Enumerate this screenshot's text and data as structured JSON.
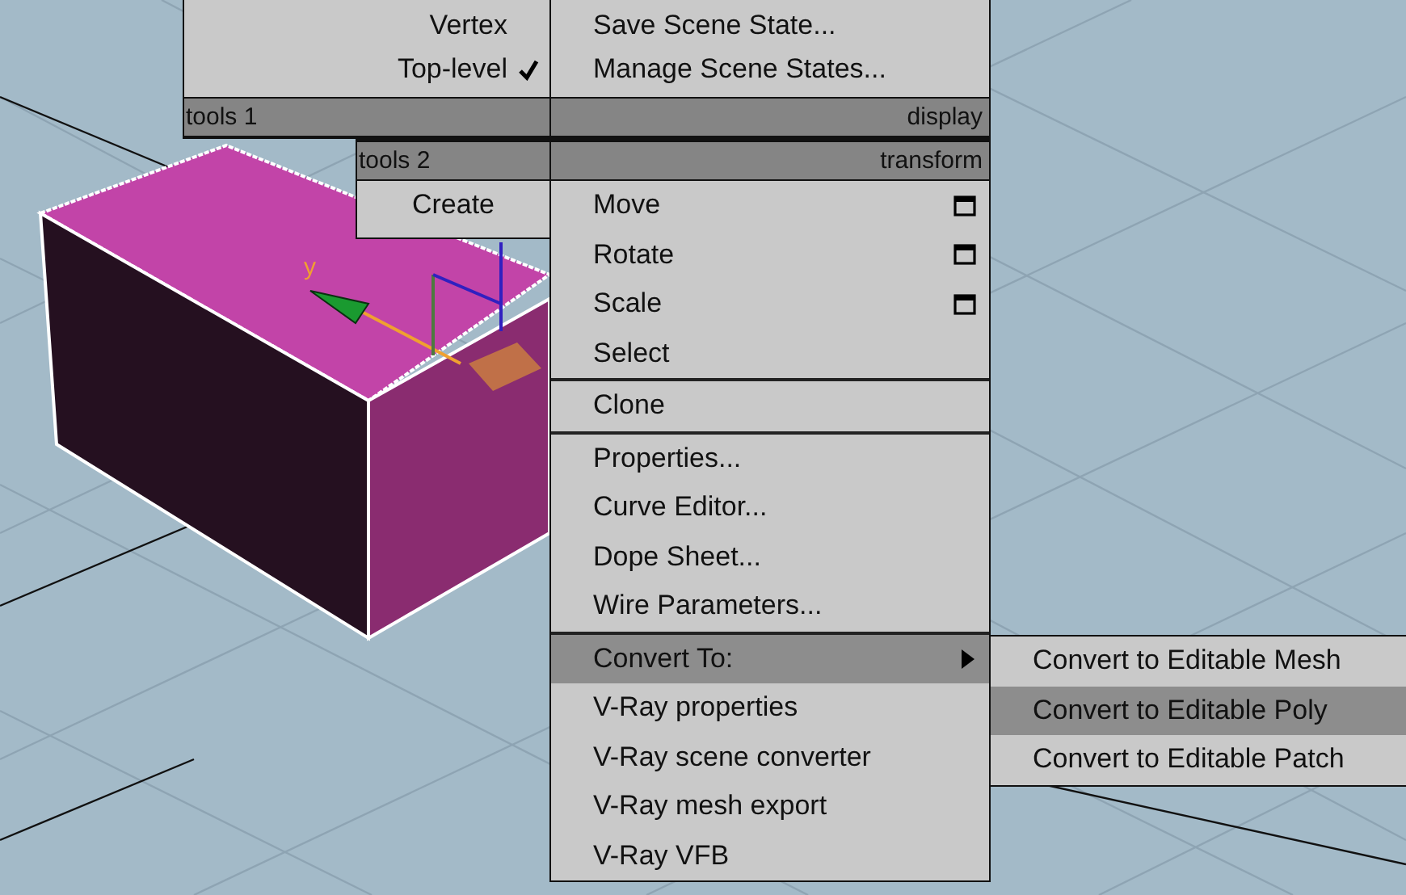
{
  "viewport": {
    "gizmo_axis_label": "y"
  },
  "quad_menu": {
    "tools_1": {
      "header": "tools 1",
      "items": [
        {
          "label": "Vertex",
          "checked": false
        },
        {
          "label": "Top-level",
          "checked": true
        }
      ]
    },
    "display": {
      "header": "display",
      "items": [
        {
          "label": "Save Scene State..."
        },
        {
          "label": "Manage Scene States..."
        }
      ]
    },
    "tools_2": {
      "header": "tools 2",
      "items": [
        {
          "label": "Create"
        }
      ]
    },
    "transform": {
      "header": "transform",
      "groups": [
        [
          {
            "label": "Move",
            "option_box": true,
            "submenu": false,
            "selected": false
          },
          {
            "label": "Rotate",
            "option_box": true,
            "submenu": false,
            "selected": false
          },
          {
            "label": "Scale",
            "option_box": true,
            "submenu": false,
            "selected": false
          },
          {
            "label": "Select",
            "option_box": false,
            "submenu": false,
            "selected": false
          }
        ],
        [
          {
            "label": "Clone",
            "option_box": false,
            "submenu": false,
            "selected": false
          }
        ],
        [
          {
            "label": "Properties...",
            "option_box": false,
            "submenu": false,
            "selected": false
          },
          {
            "label": "Curve Editor...",
            "option_box": false,
            "submenu": false,
            "selected": false
          },
          {
            "label": "Dope Sheet...",
            "option_box": false,
            "submenu": false,
            "selected": false
          },
          {
            "label": "Wire Parameters...",
            "option_box": false,
            "submenu": false,
            "selected": false
          }
        ],
        [
          {
            "label": "Convert To:",
            "option_box": false,
            "submenu": true,
            "selected": true
          },
          {
            "label": "V-Ray properties",
            "option_box": false,
            "submenu": false,
            "selected": false
          },
          {
            "label": "V-Ray scene converter",
            "option_box": false,
            "submenu": false,
            "selected": false
          },
          {
            "label": "V-Ray mesh export",
            "option_box": false,
            "submenu": false,
            "selected": false
          },
          {
            "label": "V-Ray VFB",
            "option_box": false,
            "submenu": false,
            "selected": false
          }
        ]
      ]
    },
    "submenu": {
      "items": [
        {
          "label": "Convert to Editable Mesh",
          "selected": false
        },
        {
          "label": "Convert to Editable Poly",
          "selected": true
        },
        {
          "label": "Convert to Editable Patch",
          "selected": false
        }
      ]
    }
  }
}
